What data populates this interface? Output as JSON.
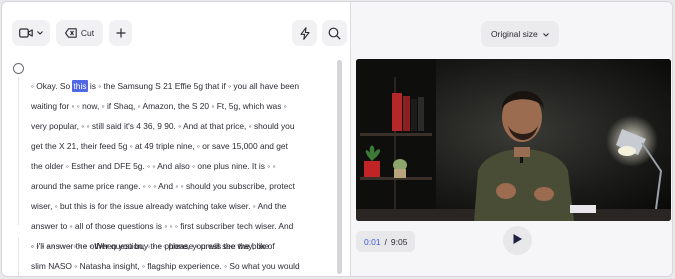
{
  "toolbar": {
    "camera_icon": "video-camera-icon",
    "cut_label": "Cut",
    "cut_icon": "backspace-icon",
    "add_icon": "plus-icon",
    "lightning_icon": "lightning-icon",
    "search_icon": "search-icon"
  },
  "transcript": {
    "paragraph1": [
      {
        "pre": "◦ Okay. So ",
        "hl": "this",
        "post": " is ◦ the Samsung S 21 Effie 5g that if ◦ you all have been"
      },
      {
        "pre": "waiting for ◦ ◦ now, ◦ if Shaq, ◦ Amazon, the S 20 ◦ Ft, 5g, which was ◦"
      },
      {
        "pre": "very popular, ◦ ◦ still said it's 4 36, 9 90. ◦ And at that price, ◦ should you"
      },
      {
        "pre": "get the X 21, their feed 5g ◦ at 49 triple nine, ◦ or save 15,000 and get"
      },
      {
        "pre": "the older ◦ Esther and DFE 5g. ◦ ◦ And also ◦ one plus nine. It is ◦ ◦"
      },
      {
        "pre": "around the same price range. ◦ ◦ ◦ And ◦ ◦ should you subscribe, protect"
      },
      {
        "pre": "wiser, ◦ but this is for the issue already watching take wiser. ◦ And the"
      },
      {
        "pre": "answer to ◦ all of those questions is ◦ ◦ ◦ first subscriber tech wiser. And"
      },
      {
        "pre": "◦ I'll answer the other question, ◦ ◦ ◦ ◦ please ◦ press the way, like"
      }
    ],
    "paragraph2": [
      {
        "pre": "◦ ◦ ◦ ◦ ◦ ◦ ◦ ◦ ◦ ◦ ◦ ◦ When you buy the phone, you will see the box of"
      },
      {
        "pre": "slim NASO ◦ Natasha insight, ◦ flagship experience. ◦ So what you would"
      }
    ]
  },
  "preview": {
    "size_label": "Original size",
    "time_current": "0:01",
    "time_separator": "/",
    "time_total": "9:05",
    "play_icon": "play-icon"
  },
  "colors": {
    "accent": "#3d5bd9",
    "highlight": "#5067e6",
    "button_bg": "#f1f1f4"
  }
}
